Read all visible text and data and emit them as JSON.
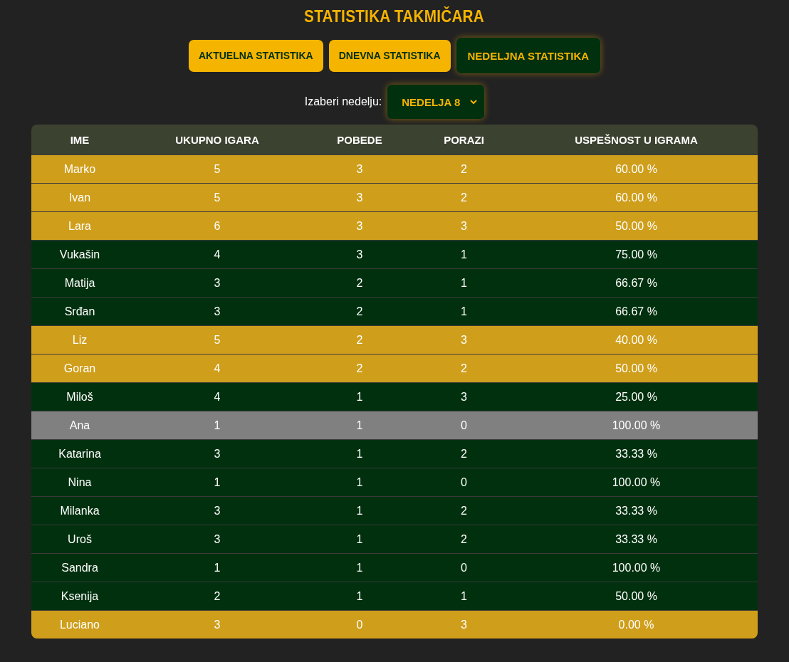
{
  "title": "STATISTIKA TAKMIČARA",
  "tabs": [
    {
      "label": "AKTUELNA STATISTIKA",
      "selected": false
    },
    {
      "label": "DNEVNA STATISTIKA",
      "selected": false
    },
    {
      "label": "NEDELJNA STATISTIKA",
      "selected": true
    }
  ],
  "week_picker": {
    "label": "Izaberi nedelju:",
    "value": "NEDELJA 8"
  },
  "table": {
    "columns": [
      "IME",
      "UKUPNO IGARA",
      "POBEDE",
      "PORAZI",
      "USPEŠNOST U IGRAMA"
    ],
    "rows": [
      {
        "cells": [
          "Marko",
          "5",
          "3",
          "2",
          "60.00 %"
        ],
        "color": "#cf9e1b"
      },
      {
        "cells": [
          "Ivan",
          "5",
          "3",
          "2",
          "60.00 %"
        ],
        "color": "#cf9e1b"
      },
      {
        "cells": [
          "Lara",
          "6",
          "3",
          "3",
          "50.00 %"
        ],
        "color": "#cf9e1b"
      },
      {
        "cells": [
          "Vukašin",
          "4",
          "3",
          "1",
          "75.00 %"
        ],
        "color": "#00300e"
      },
      {
        "cells": [
          "Matija",
          "3",
          "2",
          "1",
          "66.67 %"
        ],
        "color": "#00300e"
      },
      {
        "cells": [
          "Srđan",
          "3",
          "2",
          "1",
          "66.67 %"
        ],
        "color": "#00300e"
      },
      {
        "cells": [
          "Liz",
          "5",
          "2",
          "3",
          "40.00 %"
        ],
        "color": "#cf9e1b"
      },
      {
        "cells": [
          "Goran",
          "4",
          "2",
          "2",
          "50.00 %"
        ],
        "color": "#cf9e1b"
      },
      {
        "cells": [
          "Miloš",
          "4",
          "1",
          "3",
          "25.00 %"
        ],
        "color": "#00300e"
      },
      {
        "cells": [
          "Ana",
          "1",
          "1",
          "0",
          "100.00 %"
        ],
        "color": "#808080"
      },
      {
        "cells": [
          "Katarina",
          "3",
          "1",
          "2",
          "33.33 %"
        ],
        "color": "#00300e"
      },
      {
        "cells": [
          "Nina",
          "1",
          "1",
          "0",
          "100.00 %"
        ],
        "color": "#00300e"
      },
      {
        "cells": [
          "Milanka",
          "3",
          "1",
          "2",
          "33.33 %"
        ],
        "color": "#00300e"
      },
      {
        "cells": [
          "Uroš",
          "3",
          "1",
          "2",
          "33.33 %"
        ],
        "color": "#00300e"
      },
      {
        "cells": [
          "Sandra",
          "1",
          "1",
          "0",
          "100.00 %"
        ],
        "color": "#00300e"
      },
      {
        "cells": [
          "Ksenija",
          "2",
          "1",
          "1",
          "50.00 %"
        ],
        "color": "#00300e"
      },
      {
        "cells": [
          "Luciano",
          "3",
          "0",
          "3",
          "0.00 %"
        ],
        "color": "#cf9e1b"
      }
    ]
  }
}
